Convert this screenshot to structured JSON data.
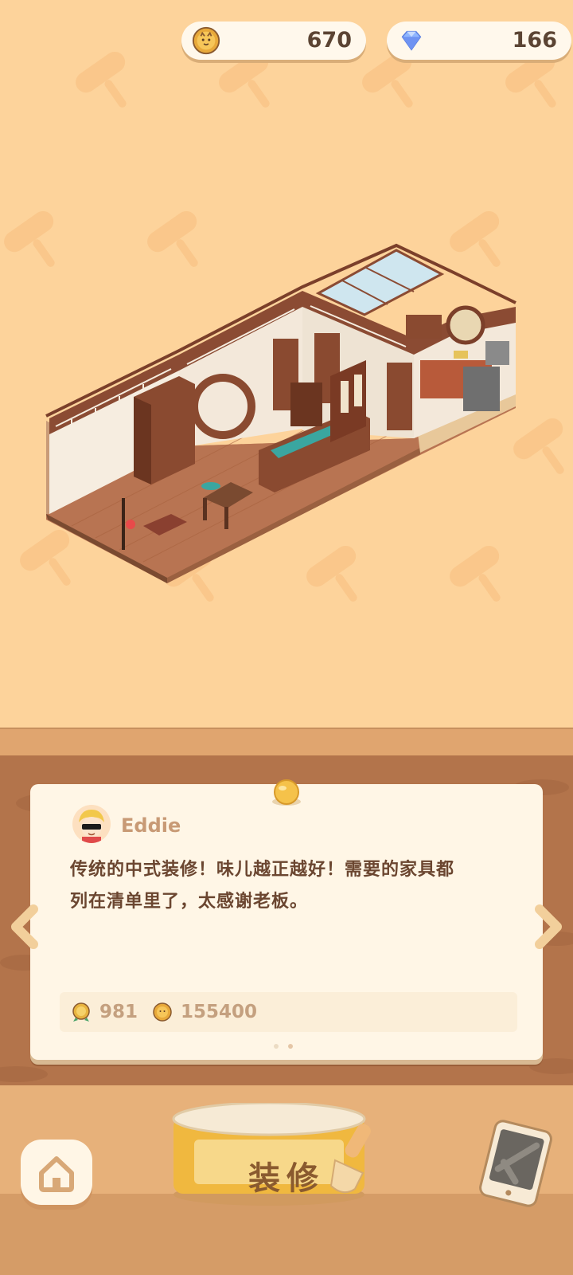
{
  "currency": {
    "coins": "670",
    "gems": "166",
    "coin_icon": "cat-coin-icon",
    "gem_icon": "diamond-icon"
  },
  "dialog": {
    "speaker": "Eddie",
    "message_line1": "传统的中式装修！味儿越正越好！需要的家具都",
    "message_line2": "列在清单里了，太感谢老板。",
    "rewards": [
      {
        "icon": "medal-icon",
        "value": "981"
      },
      {
        "icon": "cat-coin-icon",
        "value": "155400"
      }
    ],
    "page_count": 2,
    "active_page": 2
  },
  "actions": {
    "home_icon": "home-icon",
    "decorate_label": "装修",
    "tablet_icon": "tablet-icon"
  },
  "colors": {
    "background": "#fdd39b",
    "wood": "#b3744b",
    "card": "#fff6e6",
    "text_dark": "#6b4630",
    "button_gold": "#f5c24a"
  }
}
